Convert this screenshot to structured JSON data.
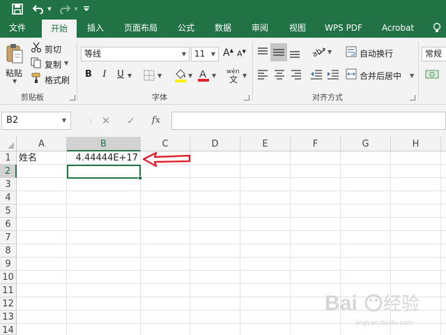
{
  "colors": {
    "brand": "#217346",
    "annotation_arrow": "#e0202a",
    "ribbon_bg": "#f3f3f3"
  },
  "titlebar": {
    "icons": [
      "save-icon",
      "undo-icon",
      "redo-icon",
      "customize-quick-access-icon"
    ]
  },
  "menu": {
    "tabs": [
      {
        "label": "文件"
      },
      {
        "label": "开始",
        "active": true
      },
      {
        "label": "插入"
      },
      {
        "label": "页面布局"
      },
      {
        "label": "公式"
      },
      {
        "label": "数据"
      },
      {
        "label": "审阅"
      },
      {
        "label": "视图"
      },
      {
        "label": "WPS PDF"
      },
      {
        "label": "Acrobat"
      }
    ],
    "lightbulb_icon": "lightbulb-icon"
  },
  "ribbon": {
    "clipboard": {
      "paste": "粘贴",
      "cut": "剪切",
      "copy": "复制",
      "format_painter": "格式刷",
      "group": "剪贴板"
    },
    "font": {
      "name": "等线",
      "size": "11",
      "group": "字体",
      "bold": "B",
      "italic": "I",
      "underline": "U",
      "grow": "A",
      "shrink": "A",
      "phonetic": "wén"
    },
    "alignment": {
      "wrap_text": "自动换行",
      "merge_center": "合并后居中",
      "group": "对齐方式"
    },
    "number": {
      "format": "常规"
    }
  },
  "formula_bar": {
    "name_box": "B2",
    "cancel": "✕",
    "enter": "✓",
    "fx": "fx",
    "value": ""
  },
  "sheet": {
    "columns": [
      "A",
      "B",
      "C",
      "D",
      "E",
      "F",
      "G",
      "H"
    ],
    "rows": [
      "1",
      "2",
      "3",
      "4",
      "5",
      "6",
      "7",
      "8",
      "9",
      "10",
      "11",
      "12",
      "13",
      "14"
    ],
    "cells": {
      "A1": "姓名",
      "B1": "4.44444E+17"
    },
    "selected_cell": "B2"
  },
  "watermark": {
    "text": "jingyan.baidu.com"
  }
}
